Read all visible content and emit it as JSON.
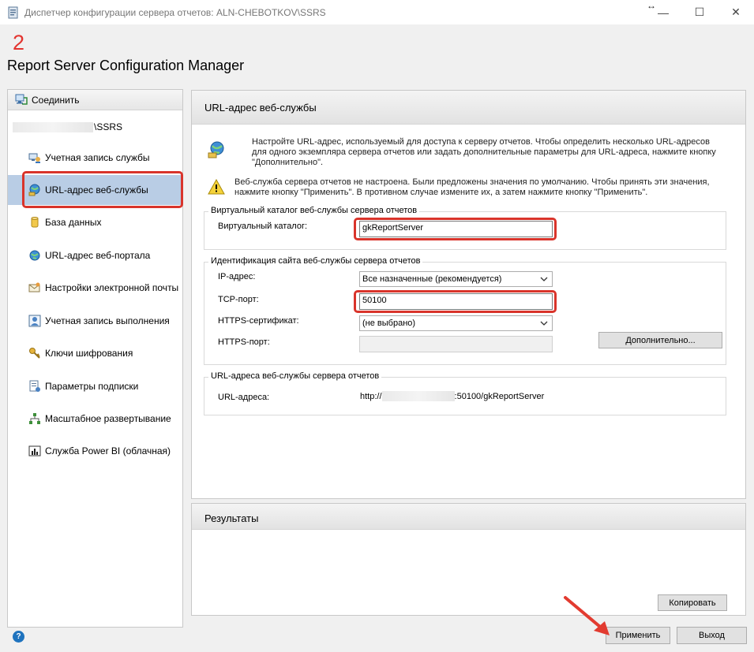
{
  "window": {
    "title": "Диспетчер конфигурации сервера отчетов: ALN-CHEBOTKOV\\SSRS",
    "minimize_glyph": "—",
    "maximize_glyph": "☐",
    "close_glyph": "✕",
    "resize_glyph": "↔"
  },
  "header": {
    "step_number": "2",
    "app_name": "Report Server Configuration Manager"
  },
  "sidebar": {
    "connect_label": "Соединить",
    "server_suffix": "\\SSRS",
    "items": [
      {
        "label": "Учетная запись службы",
        "icon": "service-account-icon"
      },
      {
        "label": "URL-адрес веб-службы",
        "icon": "web-service-url-icon",
        "selected": true
      },
      {
        "label": "База данных",
        "icon": "database-icon"
      },
      {
        "label": "URL-адрес веб-портала",
        "icon": "globe-icon"
      },
      {
        "label": "Настройки электронной почты",
        "icon": "email-icon"
      },
      {
        "label": "Учетная запись выполнения",
        "icon": "execution-account-icon"
      },
      {
        "label": "Ключи шифрования",
        "icon": "keys-icon"
      },
      {
        "label": "Параметры подписки",
        "icon": "subscription-icon"
      },
      {
        "label": "Масштабное развертывание",
        "icon": "scaleout-icon"
      },
      {
        "label": "Служба Power BI (облачная)",
        "icon": "power-bi-icon"
      }
    ]
  },
  "main": {
    "title": "URL-адрес веб-службы",
    "intro_lines": [
      "Настройте URL-адрес, используемый для доступа к серверу отчетов. Чтобы определить несколько URL-адресов",
      "для одного экземпляра сервера отчетов или задать дополнительные параметры для URL-адреса, нажмите кнопку",
      "\"Дополнительно\"."
    ],
    "warning_lines": [
      "Веб-служба сервера отчетов не настроена. Были предложены значения по умолчанию. Чтобы принять эти значения,",
      "нажмите кнопку \"Применить\". В противном случае измените их, а затем нажмите кнопку \"Применить\"."
    ],
    "virtual_dir": {
      "group_label": "Виртуальный каталог веб-службы сервера отчетов",
      "field_label": "Виртуальный каталог:",
      "value": "gkReportServer"
    },
    "site_identity": {
      "group_label": "Идентификация сайта веб-службы сервера отчетов",
      "ip_label": "IP-адрес:",
      "ip_value": "Все назначенные (рекомендуется)",
      "tcp_label": "TCP-порт:",
      "tcp_value": "50100",
      "https_cert_label": "HTTPS-сертификат:",
      "https_cert_value": "(не выбрано)",
      "https_port_label": "HTTPS-порт:",
      "https_port_value": "",
      "advanced_button": "Дополнительно..."
    },
    "urls": {
      "group_label": "URL-адреса веб-службы сервера отчетов",
      "field_label": "URL-адреса:",
      "url_prefix": "http://",
      "url_suffix": ":50100/gkReportServer"
    }
  },
  "results": {
    "title": "Результаты",
    "copy_button": "Копировать"
  },
  "footer": {
    "help_glyph": "?",
    "apply_button": "Применить",
    "exit_button": "Выход"
  },
  "colors": {
    "highlight": "#d9342b",
    "selected_nav": "#b9cde5",
    "arrow": "#e23b30"
  }
}
